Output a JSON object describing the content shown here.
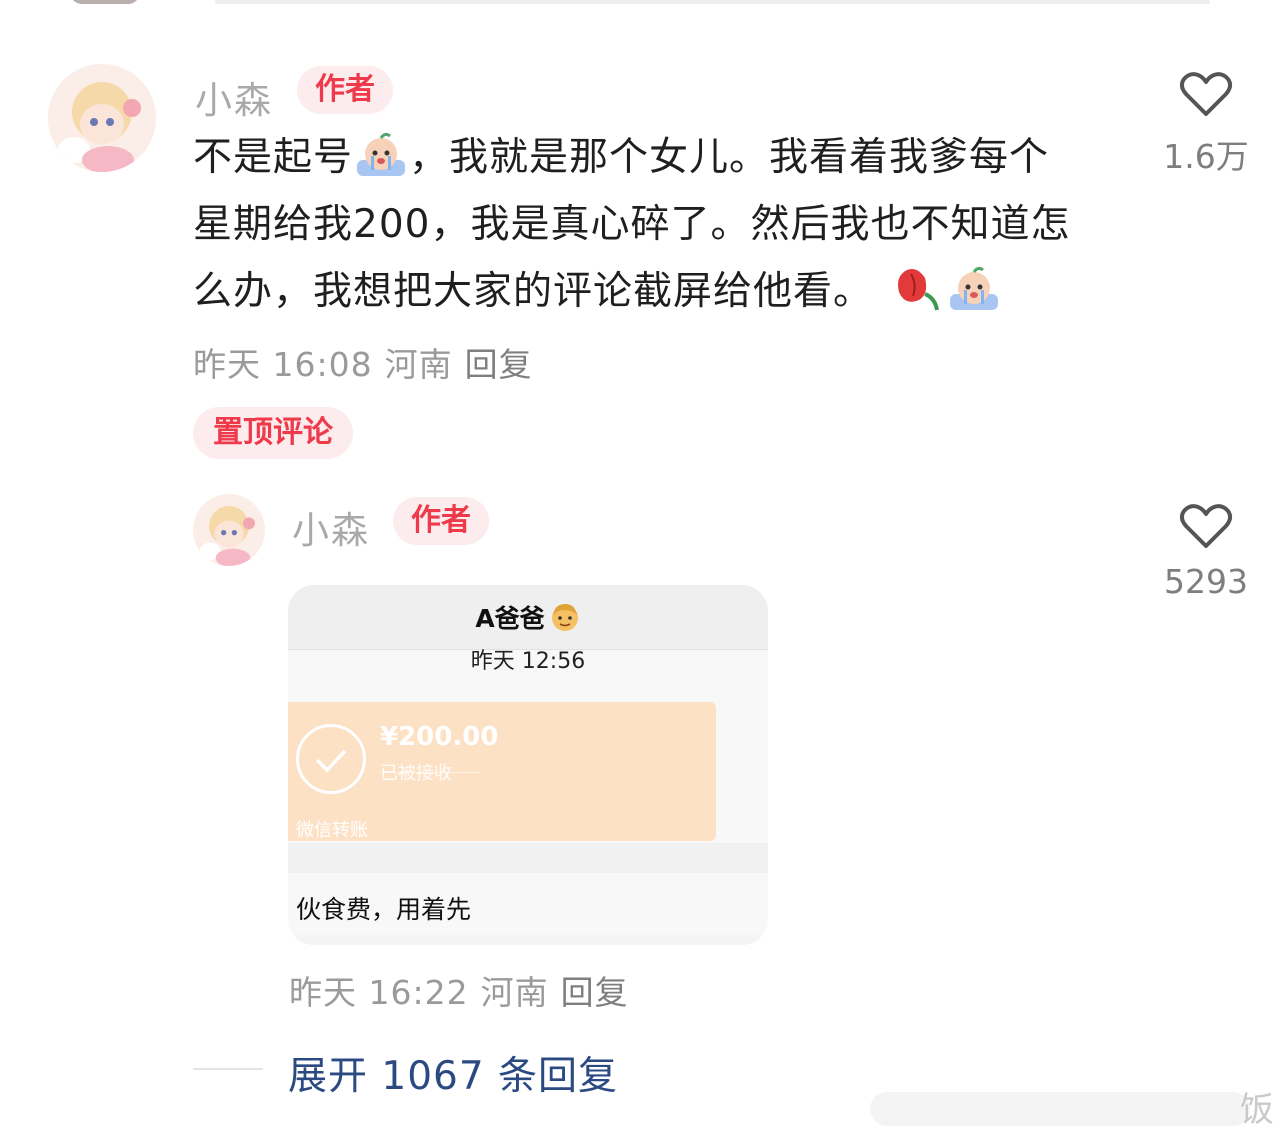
{
  "comment": {
    "username": "小森",
    "author_badge": "作者",
    "text_line1_a": "不是起号",
    "text_line1_b": "，我就是那个女儿。我看着我爹每个",
    "text_line2": "星期给我200，我是真心碎了。然后我也不知道怎",
    "text_line3": "么办，我想把大家的评论截屏给他看。",
    "emoji_1": "crying-emoji",
    "emoji_2": "wilted-rose-emoji",
    "emoji_3": "crying-emoji",
    "time": "昨天 16:08",
    "location": "河南",
    "reply_label": "回复",
    "pin_label": "置顶评论",
    "likes": "1.6万"
  },
  "reply": {
    "username": "小森",
    "author_badge": "作者",
    "likes": "5293",
    "time": "昨天 16:22",
    "location": "河南",
    "reply_label": "回复",
    "screenshot": {
      "contact": "A爸爸",
      "contact_emoji": "man-face-emoji",
      "time": "昨天 12:56",
      "amount": "¥200.00",
      "status": "已被接收",
      "transfer_label": "微信转账",
      "note": "伙食费，用着先"
    }
  },
  "expand_label": "展开 1067 条回复",
  "watermark": "饭",
  "colors": {
    "accent_red": "#ee3a4b",
    "badge_bg": "#fdecee",
    "link_blue": "#2b4a82",
    "transfer_card": "#fde1c5"
  }
}
